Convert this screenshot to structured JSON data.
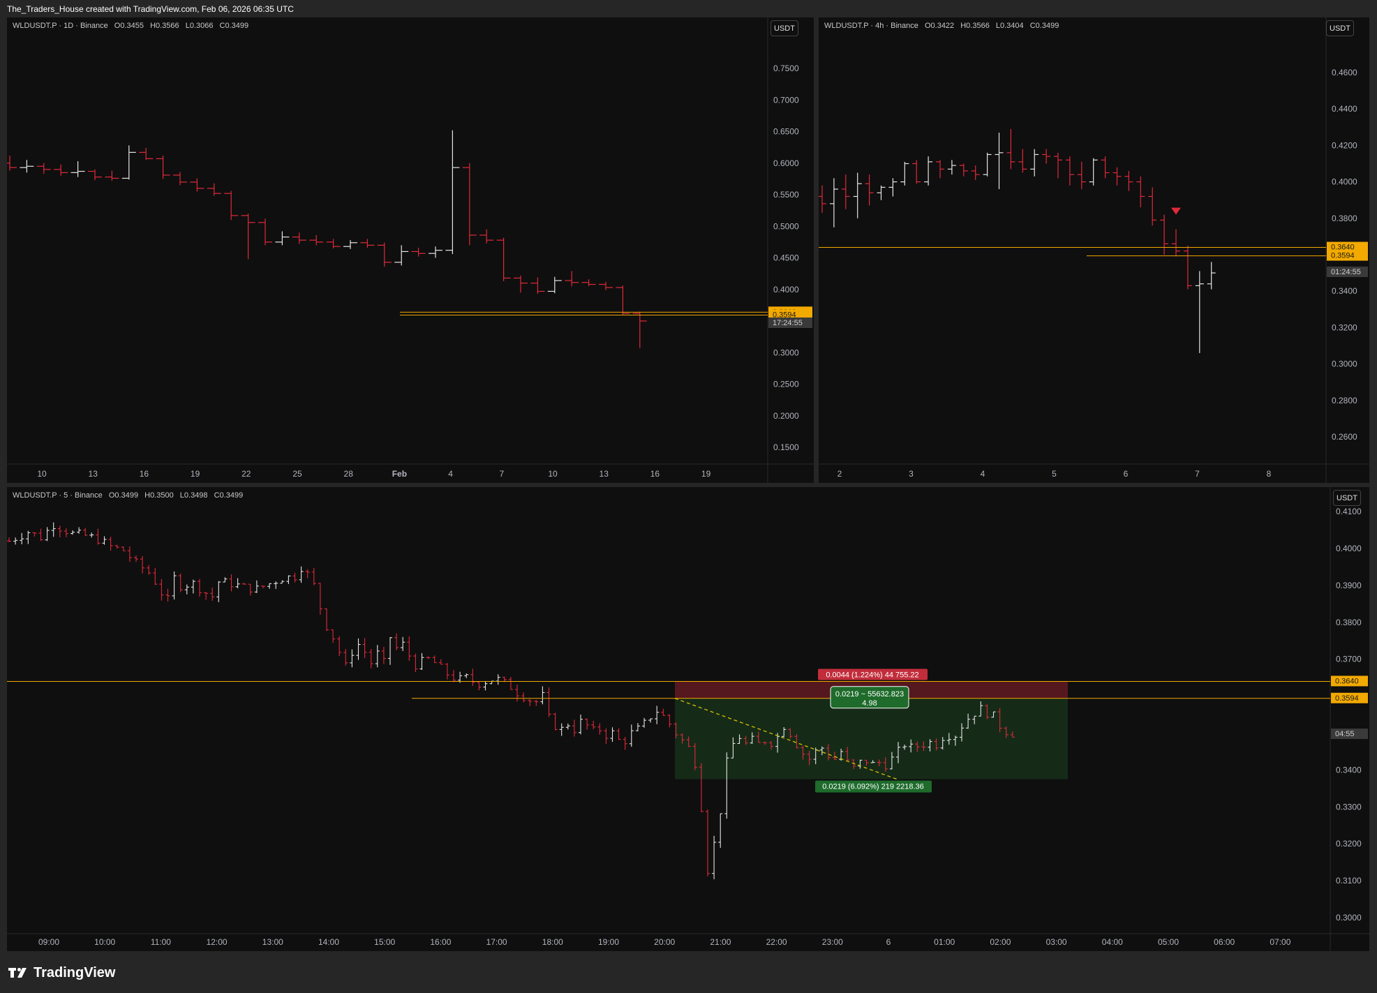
{
  "header": {
    "text": "The_Traders_House created with TradingView.com, Feb 06, 2026 06:35 UTC"
  },
  "footer": {
    "brand": "TradingView"
  },
  "colors": {
    "up": "#e6e6e6",
    "down": "#e0293a",
    "level": "#f2a900",
    "bg": "#0f0f0f",
    "axis_text": "#b2b5be"
  },
  "chart_data": [
    {
      "id": "daily",
      "type": "ohlc",
      "legend": {
        "symbol": "WLDUSDT.P · 1D · Binance",
        "o": "O0.3455",
        "h": "H0.3566",
        "l": "L0.3066",
        "c": "C0.3499"
      },
      "currency": "USDT",
      "y_ticks": [
        "0.7500",
        "0.7000",
        "0.6500",
        "0.6000",
        "0.5500",
        "0.5000",
        "0.4500",
        "0.4000",
        "0.3500",
        "0.3000",
        "0.2500",
        "0.2000",
        "0.1500"
      ],
      "ylim": [
        0.125,
        0.8
      ],
      "x_ticks": [
        "10",
        "13",
        "16",
        "19",
        "22",
        "25",
        "28",
        "Feb",
        "4",
        "7",
        "10",
        "13",
        "16",
        "19"
      ],
      "levels": [
        {
          "label": "0.3640",
          "value": 0.364
        },
        {
          "label": "0.3594",
          "value": 0.3594
        }
      ],
      "countdown": "17:24:55",
      "bars": [
        [
          0.6,
          0.612,
          0.588,
          0.593
        ],
        [
          0.593,
          0.605,
          0.585,
          0.595
        ],
        [
          0.595,
          0.6,
          0.583,
          0.59
        ],
        [
          0.59,
          0.598,
          0.58,
          0.585
        ],
        [
          0.585,
          0.603,
          0.578,
          0.587
        ],
        [
          0.587,
          0.59,
          0.573,
          0.578
        ],
        [
          0.578,
          0.588,
          0.572,
          0.576
        ],
        [
          0.576,
          0.628,
          0.574,
          0.617
        ],
        [
          0.617,
          0.624,
          0.605,
          0.607
        ],
        [
          0.607,
          0.612,
          0.575,
          0.581
        ],
        [
          0.581,
          0.586,
          0.565,
          0.57
        ],
        [
          0.57,
          0.576,
          0.555,
          0.56
        ],
        [
          0.56,
          0.568,
          0.548,
          0.552
        ],
        [
          0.552,
          0.556,
          0.51,
          0.517
        ],
        [
          0.517,
          0.52,
          0.448,
          0.506
        ],
        [
          0.506,
          0.512,
          0.47,
          0.475
        ],
        [
          0.475,
          0.492,
          0.47,
          0.483
        ],
        [
          0.483,
          0.49,
          0.472,
          0.478
        ],
        [
          0.478,
          0.486,
          0.47,
          0.475
        ],
        [
          0.475,
          0.48,
          0.465,
          0.468
        ],
        [
          0.468,
          0.478,
          0.464,
          0.474
        ],
        [
          0.474,
          0.48,
          0.466,
          0.47
        ],
        [
          0.47,
          0.474,
          0.436,
          0.443
        ],
        [
          0.443,
          0.47,
          0.438,
          0.46
        ],
        [
          0.46,
          0.466,
          0.452,
          0.457
        ],
        [
          0.457,
          0.468,
          0.45,
          0.462
        ],
        [
          0.462,
          0.652,
          0.456,
          0.593
        ],
        [
          0.593,
          0.6,
          0.47,
          0.486
        ],
        [
          0.486,
          0.495,
          0.473,
          0.478
        ],
        [
          0.478,
          0.482,
          0.413,
          0.418
        ],
        [
          0.418,
          0.422,
          0.395,
          0.41
        ],
        [
          0.41,
          0.419,
          0.393,
          0.397
        ],
        [
          0.397,
          0.42,
          0.394,
          0.414
        ],
        [
          0.414,
          0.429,
          0.405,
          0.411
        ],
        [
          0.411,
          0.416,
          0.405,
          0.408
        ],
        [
          0.408,
          0.412,
          0.399,
          0.403
        ],
        [
          0.403,
          0.406,
          0.359,
          0.362
        ],
        [
          0.362,
          0.365,
          0.307,
          0.35
        ]
      ],
      "x_start": 10
    },
    {
      "id": "four_hour",
      "type": "ohlc",
      "legend": {
        "symbol": "WLDUSDT.P · 4h · Binance",
        "o": "O0.3422",
        "h": "H0.3566",
        "l": "L0.3404",
        "c": "C0.3499"
      },
      "currency": "USDT",
      "y_ticks": [
        "0.4600",
        "0.4400",
        "0.4200",
        "0.4000",
        "0.3800",
        "0.3600",
        "0.3400",
        "0.3200",
        "0.3000",
        "0.2800",
        "0.2600"
      ],
      "ylim": [
        0.247,
        0.488
      ],
      "x_ticks": [
        "2",
        "3",
        "4",
        "5",
        "6",
        "7",
        "8"
      ],
      "levels": [
        {
          "label": "0.3640",
          "value": 0.364
        },
        {
          "label": "0.3594",
          "value": 0.3594
        }
      ],
      "countdown": "01:24:55",
      "signal": {
        "type": "sell-marker",
        "value": 0.3835
      },
      "bars": [
        [
          0.392,
          0.398,
          0.383,
          0.388
        ],
        [
          0.388,
          0.402,
          0.375,
          0.396
        ],
        [
          0.396,
          0.404,
          0.385,
          0.392
        ],
        [
          0.392,
          0.405,
          0.38,
          0.399
        ],
        [
          0.399,
          0.404,
          0.387,
          0.394
        ],
        [
          0.394,
          0.398,
          0.39,
          0.397
        ],
        [
          0.397,
          0.402,
          0.392,
          0.4
        ],
        [
          0.4,
          0.411,
          0.398,
          0.41
        ],
        [
          0.41,
          0.412,
          0.399,
          0.4
        ],
        [
          0.4,
          0.414,
          0.398,
          0.411
        ],
        [
          0.411,
          0.412,
          0.402,
          0.407
        ],
        [
          0.407,
          0.412,
          0.404,
          0.409
        ],
        [
          0.409,
          0.41,
          0.403,
          0.406
        ],
        [
          0.406,
          0.409,
          0.401,
          0.404
        ],
        [
          0.404,
          0.416,
          0.403,
          0.415
        ],
        [
          0.415,
          0.427,
          0.396,
          0.416
        ],
        [
          0.416,
          0.429,
          0.407,
          0.411
        ],
        [
          0.411,
          0.418,
          0.405,
          0.407
        ],
        [
          0.407,
          0.418,
          0.403,
          0.415
        ],
        [
          0.415,
          0.418,
          0.41,
          0.414
        ],
        [
          0.414,
          0.416,
          0.402,
          0.412
        ],
        [
          0.412,
          0.414,
          0.398,
          0.404
        ],
        [
          0.404,
          0.411,
          0.396,
          0.4
        ],
        [
          0.4,
          0.413,
          0.398,
          0.412
        ],
        [
          0.412,
          0.414,
          0.402,
          0.405
        ],
        [
          0.405,
          0.408,
          0.398,
          0.403
        ],
        [
          0.403,
          0.406,
          0.395,
          0.4
        ],
        [
          0.4,
          0.403,
          0.386,
          0.392
        ],
        [
          0.392,
          0.397,
          0.376,
          0.379
        ],
        [
          0.379,
          0.382,
          0.36,
          0.366
        ],
        [
          0.366,
          0.374,
          0.359,
          0.362
        ],
        [
          0.362,
          0.365,
          0.341,
          0.343
        ],
        [
          0.343,
          0.351,
          0.306,
          0.344
        ],
        [
          0.344,
          0.356,
          0.341,
          0.35
        ]
      ],
      "x_first_label_index": 1
    },
    {
      "id": "five_min",
      "type": "ohlc",
      "legend": {
        "symbol": "WLDUSDT.P · 5 · Binance",
        "o": "O0.3499",
        "h": "H0.3500",
        "l": "L0.3498",
        "c": "C0.3499"
      },
      "currency": "USDT",
      "y_ticks": [
        "0.4100",
        "0.4000",
        "0.3900",
        "0.3800",
        "0.3700",
        "0.3600",
        "0.3500",
        "0.3400",
        "0.3300",
        "0.3200",
        "0.3100",
        "0.3000"
      ],
      "ylim": [
        0.2967,
        0.4107
      ],
      "x_ticks": [
        "09:00",
        "10:00",
        "11:00",
        "12:00",
        "13:00",
        "14:00",
        "15:00",
        "16:00",
        "17:00",
        "18:00",
        "19:00",
        "20:00",
        "21:00",
        "22:00",
        "23:00",
        "6",
        "01:00",
        "02:00",
        "03:00",
        "04:00",
        "05:00",
        "06:00",
        "07:00"
      ],
      "levels": [
        {
          "label": "0.3640",
          "value": 0.364
        },
        {
          "label": "0.3594",
          "value": 0.3594
        }
      ],
      "countdown": "04:55",
      "position": {
        "entry": 0.3594,
        "stop": 0.364,
        "target": 0.3375,
        "stop_label": "0.0044 (1.224%) 44 755.22",
        "info_label_1": "0.0219 ~ 55632.823",
        "info_label_2": "4.98",
        "target_label": "0.0219 (6.092%) 219 2218.36"
      },
      "path": [
        [
          0,
          0.402
        ],
        [
          3,
          0.4045
        ],
        [
          5,
          0.403
        ],
        [
          7,
          0.4065
        ],
        [
          10,
          0.404
        ],
        [
          12,
          0.4035
        ],
        [
          14,
          0.4025
        ],
        [
          16,
          0.4005
        ],
        [
          18,
          0.3995
        ],
        [
          20,
          0.396
        ],
        [
          22,
          0.3935
        ],
        [
          23,
          0.391
        ],
        [
          24,
          0.388
        ],
        [
          25,
          0.386
        ],
        [
          26,
          0.392
        ],
        [
          27,
          0.39
        ],
        [
          29,
          0.3905
        ],
        [
          31,
          0.388
        ],
        [
          32,
          0.387
        ],
        [
          33,
          0.391
        ],
        [
          35,
          0.3905
        ],
        [
          37,
          0.3895
        ],
        [
          39,
          0.389
        ],
        [
          41,
          0.3905
        ],
        [
          43,
          0.392
        ],
        [
          45,
          0.3925
        ],
        [
          46,
          0.395
        ],
        [
          47,
          0.393
        ],
        [
          48,
          0.39
        ],
        [
          49,
          0.384
        ],
        [
          50,
          0.379
        ],
        [
          51,
          0.376
        ],
        [
          52,
          0.372
        ],
        [
          53,
          0.368
        ],
        [
          54,
          0.372
        ],
        [
          55,
          0.374
        ],
        [
          56,
          0.372
        ],
        [
          57,
          0.369
        ],
        [
          58,
          0.3715
        ],
        [
          59,
          0.369
        ],
        [
          60,
          0.376
        ],
        [
          61,
          0.373
        ],
        [
          62,
          0.374
        ],
        [
          63,
          0.371
        ],
        [
          64,
          0.3685
        ],
        [
          66,
          0.37
        ],
        [
          67,
          0.369
        ],
        [
          68,
          0.3675
        ],
        [
          69,
          0.366
        ],
        [
          70,
          0.365
        ],
        [
          71,
          0.3645
        ],
        [
          72,
          0.365
        ],
        [
          73,
          0.364
        ],
        [
          74,
          0.3635
        ],
        [
          75,
          0.364
        ],
        [
          76,
          0.3645
        ],
        [
          77,
          0.3645
        ],
        [
          78,
          0.3635
        ],
        [
          79,
          0.3625
        ],
        [
          80,
          0.361
        ],
        [
          81,
          0.36
        ],
        [
          82,
          0.359
        ],
        [
          83,
          0.3585
        ],
        [
          84,
          0.36
        ],
        [
          85,
          0.354
        ],
        [
          86,
          0.352
        ],
        [
          87,
          0.351
        ],
        [
          88,
          0.3525
        ],
        [
          89,
          0.351
        ],
        [
          90,
          0.353
        ],
        [
          91,
          0.352
        ],
        [
          92,
          0.3505
        ],
        [
          93,
          0.351
        ],
        [
          94,
          0.3495
        ],
        [
          95,
          0.35
        ],
        [
          96,
          0.348
        ],
        [
          97,
          0.348
        ],
        [
          98,
          0.35
        ],
        [
          99,
          0.351
        ],
        [
          100,
          0.3525
        ],
        [
          101,
          0.3545
        ],
        [
          102,
          0.356
        ],
        [
          103,
          0.3545
        ],
        [
          104,
          0.3525
        ],
        [
          105,
          0.35
        ],
        [
          106,
          0.348
        ],
        [
          107,
          0.346
        ],
        [
          108,
          0.342
        ],
        [
          109,
          0.33
        ],
        [
          110,
          0.313
        ],
        [
          111,
          0.32
        ],
        [
          112,
          0.329
        ],
        [
          113,
          0.342
        ],
        [
          114,
          0.347
        ],
        [
          115,
          0.349
        ],
        [
          116,
          0.347
        ],
        [
          117,
          0.348
        ],
        [
          118,
          0.347
        ],
        [
          119,
          0.348
        ],
        [
          120,
          0.3475
        ],
        [
          121,
          0.349
        ],
        [
          122,
          0.352
        ],
        [
          123,
          0.35
        ],
        [
          124,
          0.347
        ],
        [
          125,
          0.3445
        ],
        [
          126,
          0.343
        ],
        [
          127,
          0.345
        ],
        [
          128,
          0.346
        ],
        [
          129,
          0.344
        ],
        [
          130,
          0.343
        ],
        [
          131,
          0.345
        ],
        [
          132,
          0.342
        ],
        [
          133,
          0.3405
        ],
        [
          134,
          0.342
        ],
        [
          135,
          0.3425
        ],
        [
          136,
          0.3415
        ],
        [
          137,
          0.342
        ],
        [
          138,
          0.3415
        ],
        [
          139,
          0.343
        ],
        [
          140,
          0.345
        ],
        [
          141,
          0.347
        ],
        [
          142,
          0.346
        ],
        [
          143,
          0.3465
        ],
        [
          144,
          0.347
        ],
        [
          145,
          0.3475
        ],
        [
          146,
          0.347
        ],
        [
          147,
          0.349
        ],
        [
          148,
          0.3495
        ],
        [
          149,
          0.3495
        ],
        [
          150,
          0.352
        ],
        [
          151,
          0.354
        ],
        [
          152,
          0.3555
        ],
        [
          153,
          0.3565
        ],
        [
          154,
          0.3555
        ],
        [
          155,
          0.3545
        ],
        [
          156,
          0.352
        ],
        [
          157,
          0.3505
        ],
        [
          158,
          0.3499
        ]
      ]
    }
  ]
}
